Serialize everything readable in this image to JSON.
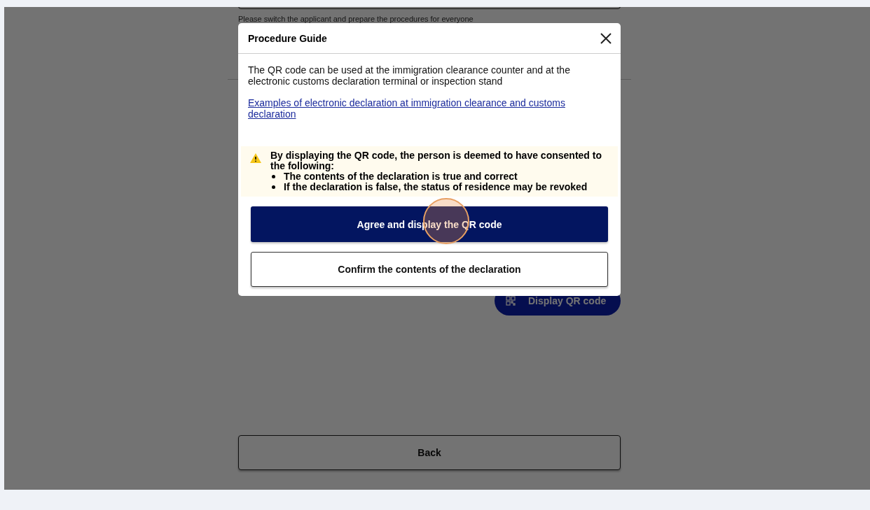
{
  "background": {
    "hint": "Please switch the applicant and prepare the procedures for everyone",
    "display_qr_button": "Display QR code",
    "back_button": "Back"
  },
  "dialog": {
    "title": "Procedure Guide",
    "description": "The QR code can be used at the immigration clearance counter and at the electronic customs declaration terminal or inspection stand",
    "link": "Examples of electronic declaration at immigration clearance and customs declaration",
    "warning": {
      "heading": "By displaying the QR code, the person is deemed to have consented to the following:",
      "items": [
        "The contents of the declaration is true and correct",
        "If the declaration is false, the status of residence may be revoked"
      ]
    },
    "buttons": [
      {
        "label": "Agree and display the QR code",
        "kind": "primary"
      },
      {
        "label": "Confirm the contents of the declaration",
        "kind": "secondary"
      }
    ]
  }
}
